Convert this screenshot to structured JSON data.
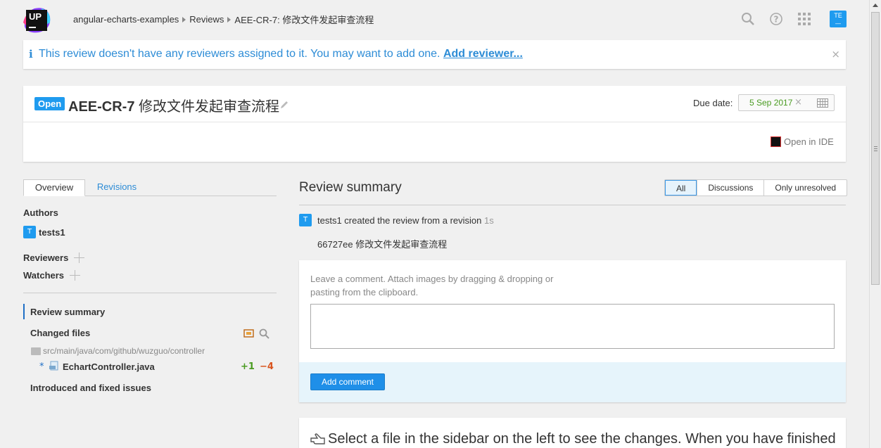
{
  "header": {
    "logo_text": "UP",
    "breadcrumb": [
      "angular-echarts-examples",
      "Reviews",
      "AEE-CR-7: 修改文件发起审查流程"
    ],
    "avatar_initials": "TE",
    "icons": [
      "search-icon",
      "help-icon",
      "apps-grid-icon"
    ]
  },
  "banner": {
    "message": "This review doesn't have any reviewers assigned to it. You may want to add one.",
    "link": "Add reviewer...",
    "close": "×"
  },
  "review": {
    "state": "Open",
    "id": "AEE-CR-7",
    "title": "修改文件发起审查流程",
    "due_label": "Due date:",
    "due_value": "5 Sep 2017",
    "due_clear": "×",
    "open_ide": "Open in IDE"
  },
  "sidebar": {
    "tabs": [
      "Overview",
      "Revisions"
    ],
    "authors_label": "Authors",
    "author": {
      "initial": "T",
      "name": "tests1"
    },
    "reviewers_label": "Reviewers",
    "watchers_label": "Watchers",
    "nav": {
      "review_summary": "Review summary",
      "changed_files": "Changed files",
      "path": "src/main/java/com/github/wuzguo/controller",
      "file_marker": "*",
      "file": "EchartController.java",
      "added": "+1",
      "removed": "−4",
      "issues": "Introduced and fixed issues"
    }
  },
  "main": {
    "title": "Review summary",
    "filters": [
      "All",
      "Discussions",
      "Only unresolved"
    ],
    "active_filter": "All",
    "event": {
      "initial": "T",
      "text": "tests1 created the review from a revision",
      "time": "1s"
    },
    "commit": "66727ee 修改文件发起审查流程",
    "comment_hint": "Leave a comment. Attach images by dragging & dropping or pasting from the clipboard.",
    "comment_value": "",
    "add_comment": "Add comment",
    "select_hint": "Select a file in the sidebar on the left to see the changes. When you have finished"
  },
  "colors": {
    "accent": "#1f9bef",
    "link": "#2d8cd6",
    "added": "#4a9b21",
    "removed": "#d9541e"
  }
}
